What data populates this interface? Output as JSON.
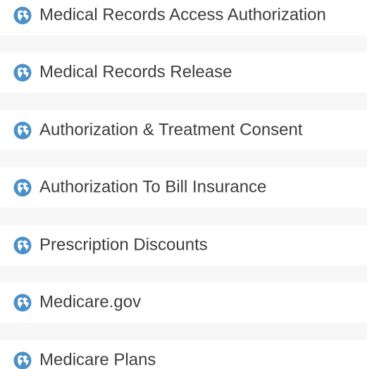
{
  "accent_color": "#4a90c9",
  "links": [
    {
      "label": "Medical Records Access Authorization",
      "icon": "globe-icon"
    },
    {
      "label": "Medical Records Release",
      "icon": "globe-icon"
    },
    {
      "label": "Authorization & Treatment Consent",
      "icon": "globe-icon"
    },
    {
      "label": "Authorization To Bill Insurance",
      "icon": "globe-icon"
    },
    {
      "label": "Prescription Discounts",
      "icon": "globe-icon"
    },
    {
      "label": "Medicare.gov",
      "icon": "globe-icon"
    },
    {
      "label": "Medicare Plans",
      "icon": "globe-icon"
    }
  ]
}
